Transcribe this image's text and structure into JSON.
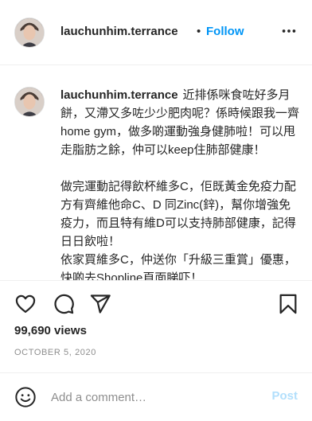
{
  "header": {
    "username": "lauchunhim.terrance",
    "separator": "•",
    "follow_label": "Follow",
    "more_icon": "more-horizontal-icon"
  },
  "caption": {
    "username": "lauchunhim.terrance",
    "text": "近排係咪食咗好多月餅，又滯又多咗少少肥肉呢？係時候跟我一齊home gym，做多啲運動強身健肺啦！可以甩走脂肪之餘，仲可以keep住肺部健康！\n\n做完運動記得飲杯維多C，佢既黃金免疫力配方有齊維他命C、D 同Zinc(鋅)，幫你增強免疫力，而且特有維D可以支持肺部健康，記得日日飲啦！\n依家買維多C，仲送你「升級三重賞」優惠，快啲去Shopline頁面睇吓！"
  },
  "actions": {
    "like_icon": "heart-icon",
    "comment_icon": "comment-icon",
    "share_icon": "share-icon",
    "save_icon": "bookmark-icon"
  },
  "stats": {
    "views": "99,690 views",
    "date": "OCTOBER 5, 2020"
  },
  "comment": {
    "emoji_icon": "emoji-icon",
    "placeholder": "Add a comment…",
    "post_label": "Post"
  },
  "colors": {
    "link_blue": "#0095f6",
    "post_disabled": "#b2dffc",
    "muted": "#8e8e8e",
    "text": "#262626"
  }
}
